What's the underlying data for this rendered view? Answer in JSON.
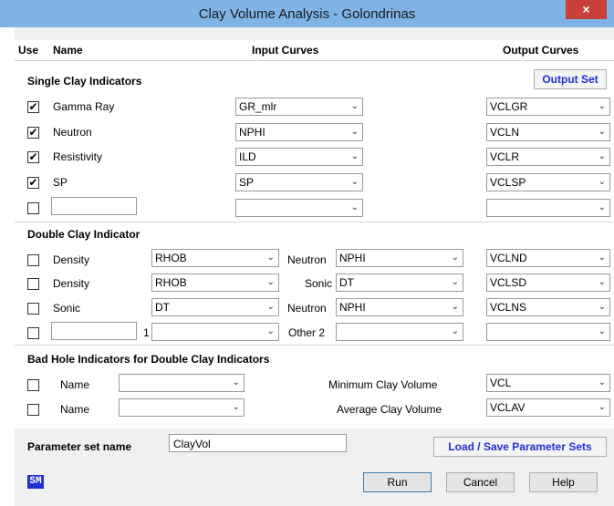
{
  "window": {
    "title": "Clay Volume Analysis - Golondrinas",
    "close_label": "×"
  },
  "header": {
    "use": "Use",
    "name": "Name",
    "input_curves": "Input Curves",
    "output_curves": "Output Curves"
  },
  "single": {
    "heading": "Single Clay Indicators",
    "output_set_label": "Output Set",
    "rows": [
      {
        "checked": "✔",
        "name": "Gamma Ray",
        "input": "GR_mlr",
        "output": "VCLGR"
      },
      {
        "checked": "✔",
        "name": "Neutron",
        "input": "NPHI",
        "output": "VCLN"
      },
      {
        "checked": "✔",
        "name": "Resistivity",
        "input": "ILD",
        "output": "VCLR"
      },
      {
        "checked": "✔",
        "name": "SP",
        "input": "SP",
        "output": "VCLSP"
      },
      {
        "checked": "",
        "name": "",
        "input": "",
        "output": ""
      }
    ]
  },
  "double": {
    "heading": "Double Clay Indicator",
    "rows": [
      {
        "name": "Density",
        "input1": "RHOB",
        "label2": "Neutron",
        "input2": "NPHI",
        "output": "VCLND"
      },
      {
        "name": "Density",
        "input1": "RHOB",
        "label2": "Sonic",
        "input2": "DT",
        "output": "VCLSD"
      },
      {
        "name": "Sonic",
        "input1": "DT",
        "label2": "Neutron",
        "input2": "NPHI",
        "output": "VCLNS"
      },
      {
        "name": "",
        "index": "1",
        "input1": "",
        "label2": "Other 2",
        "input2": "",
        "output": ""
      }
    ]
  },
  "badhole": {
    "heading": "Bad Hole Indicators for Double Clay Indicators",
    "rows": [
      {
        "name": "Name",
        "value": "",
        "label": "Minimum Clay Volume",
        "output": "VCL"
      },
      {
        "name": "Name",
        "value": "",
        "label": "Average Clay Volume",
        "output": "VCLAV"
      }
    ]
  },
  "params": {
    "label": "Parameter set name",
    "value": "ClayVol",
    "load_save": "Load / Save Parameter Sets"
  },
  "footer": {
    "sm": "SM",
    "run": "Run",
    "cancel": "Cancel",
    "help": "Help"
  },
  "chevron": "⌄"
}
